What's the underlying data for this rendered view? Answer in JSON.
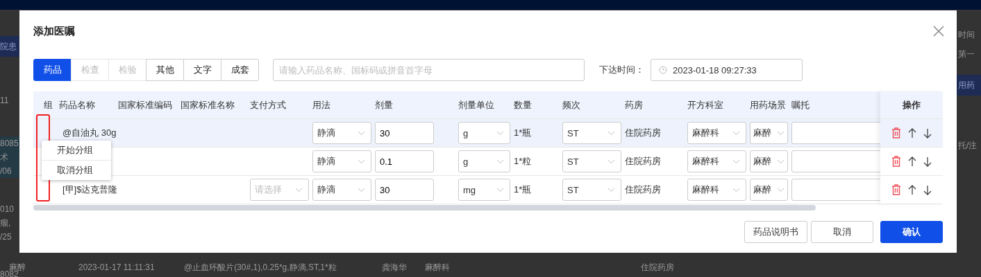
{
  "background": {
    "left_texts": [
      {
        "text": "院患",
        "kind": "button"
      },
      {
        "text": "11",
        "kind": "text"
      },
      {
        "text": "8085",
        "kind": "selected"
      },
      {
        "text": "术",
        "kind": "selected"
      },
      {
        "text": "/06",
        "kind": "selected"
      },
      {
        "text": "010",
        "kind": "text"
      },
      {
        "text": "瘤,",
        "kind": "text"
      },
      {
        "text": "/25",
        "kind": "text"
      },
      {
        "text": "8082",
        "kind": "text"
      }
    ],
    "right_texts": [
      {
        "text": "时间",
        "kind": "text"
      },
      {
        "text": "第一",
        "kind": "text"
      },
      {
        "text": "用药",
        "kind": "button"
      },
      {
        "text": "托/注",
        "kind": "text"
      }
    ],
    "bottom_row": [
      "麻醉",
      "2023-01-17 11:11:31",
      "@止血环酸片(30#,1),0.25*g,静滴,ST,1*粒",
      "龚海华",
      "麻醉科",
      "住院药房"
    ]
  },
  "dialog": {
    "title": "添加医嘱",
    "tabs": [
      {
        "label": "药品",
        "selected": true,
        "disabled": false
      },
      {
        "label": "检查",
        "selected": false,
        "disabled": true
      },
      {
        "label": "检验",
        "selected": false,
        "disabled": true
      },
      {
        "label": "其他",
        "selected": false,
        "disabled": false
      },
      {
        "label": "文字",
        "selected": false,
        "disabled": false
      },
      {
        "label": "成套",
        "selected": false,
        "disabled": false
      }
    ],
    "search": {
      "placeholder": "请输入药品名称、国标码或拼音首字母"
    },
    "time_label": "下达时间：",
    "time_value": "2023-01-18 09:27:33",
    "columns": [
      "组",
      "药品名称",
      "国家标准编码",
      "国家标准名称",
      "支付方式",
      "用法",
      "剂量",
      "剂量单位",
      "数量",
      "频次",
      "药房",
      "开方科室",
      "用药场景",
      "嘱托"
    ],
    "operations_header": "操作",
    "rows": [
      {
        "selected": true,
        "name": "@自油丸 30g",
        "usage": "静滴",
        "dose": "30",
        "unit": "g",
        "quantity": "1*瓶",
        "frequency": "ST",
        "pharmacy": "住院药房",
        "department": "麻醉科",
        "scene": "麻醉"
      },
      {
        "selected": false,
        "usage": "静滴",
        "dose": "0.1",
        "unit": "g",
        "quantity": "1*粒",
        "frequency": "ST",
        "pharmacy": "住院药房",
        "department": "麻醉科",
        "scene": "麻醉"
      },
      {
        "selected": false,
        "name": "[甲]$达克普隆",
        "payment_placeholder": "请选择",
        "usage": "静滴",
        "dose": "30",
        "unit": "mg",
        "quantity": "1*瓶",
        "frequency": "ST",
        "pharmacy": "住院药房",
        "department": "麻醉科",
        "scene": "麻醉"
      }
    ],
    "context_menu": [
      "开始分组",
      "取消分组"
    ],
    "buttons": [
      {
        "label": "药品说明书",
        "primary": false
      },
      {
        "label": "取消",
        "primary": false
      },
      {
        "label": "确认",
        "primary": true
      }
    ]
  }
}
